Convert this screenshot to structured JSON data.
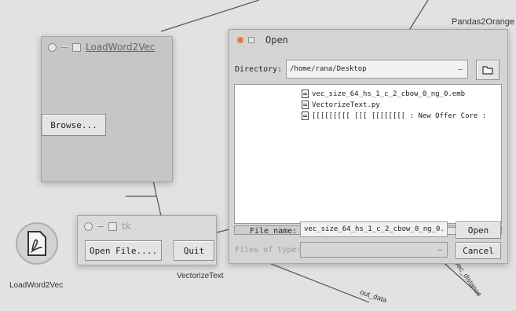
{
  "desktop": {
    "labels": {
      "top_right": "Pandas2Orange",
      "bottom_left_icon": "LoadWord2Vec",
      "center": "VectorizeText",
      "bottom_diag": "out_data",
      "right_diag": "vec_distance"
    }
  },
  "load_window": {
    "title": "LoadWord2Vec",
    "browse_label": "Browse..."
  },
  "tk_window": {
    "title": "tk",
    "open_file_label": "Open File....",
    "quit_label": "Quit"
  },
  "open_dialog": {
    "title": "Open",
    "directory_label": "Directory:",
    "directory_value": "/home/rana/Desktop",
    "files": [
      "vec_size_64_hs_1_c_2_cbow_0_ng_0.emb",
      "VectorizeText.py",
      "[[[[[[[[[ [[[ [[[[[[[[ : New Offer Core :"
    ],
    "file_name_label": "File name:",
    "file_name_value": "vec_size_64_hs_1_c_2_cbow_0_ng_0.",
    "file_type_label": "Files of type:",
    "open_label": "Open",
    "cancel_label": "Cancel"
  },
  "colors": {
    "title_dot": "#e67a4a",
    "desktop_bg": "#e3e1e1"
  }
}
